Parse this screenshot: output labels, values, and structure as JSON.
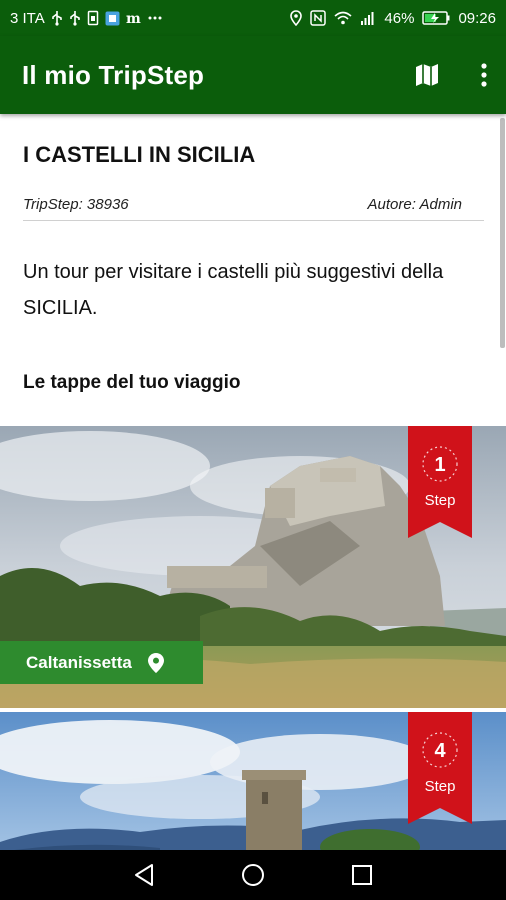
{
  "status_bar": {
    "carrier": "3 ITA",
    "battery": "46%",
    "time": "09:26",
    "icons_left": [
      "usb-icon",
      "usb-icon",
      "sim-icon",
      "app-icon",
      "m-icon",
      "more-notifications-icon"
    ],
    "icons_right": [
      "location-icon",
      "nfc-icon",
      "wifi-icon",
      "signal-icon",
      "battery-charging-icon"
    ]
  },
  "app_bar": {
    "title": "Il mio TripStep",
    "actions": [
      "map-icon",
      "overflow-menu-icon"
    ]
  },
  "trip": {
    "title": "I CASTELLI IN SICILIA",
    "tripstep_id": "TripStep: 38936",
    "author": "Autore: Admin",
    "description": "Un tour per visitare i castelli più suggestivi della SICILIA.",
    "section_title": "Le tappe del tuo viaggio"
  },
  "steps": [
    {
      "number": "1",
      "label": "Step",
      "place": "Caltanissetta"
    },
    {
      "number": "4",
      "label": "Step"
    }
  ],
  "colors": {
    "primary_dark": "#0b5d0b",
    "chip_green": "#2e8b2e",
    "ribbon_red": "#d0121a"
  },
  "nav_bar": [
    "back-icon",
    "home-icon",
    "recents-icon"
  ]
}
